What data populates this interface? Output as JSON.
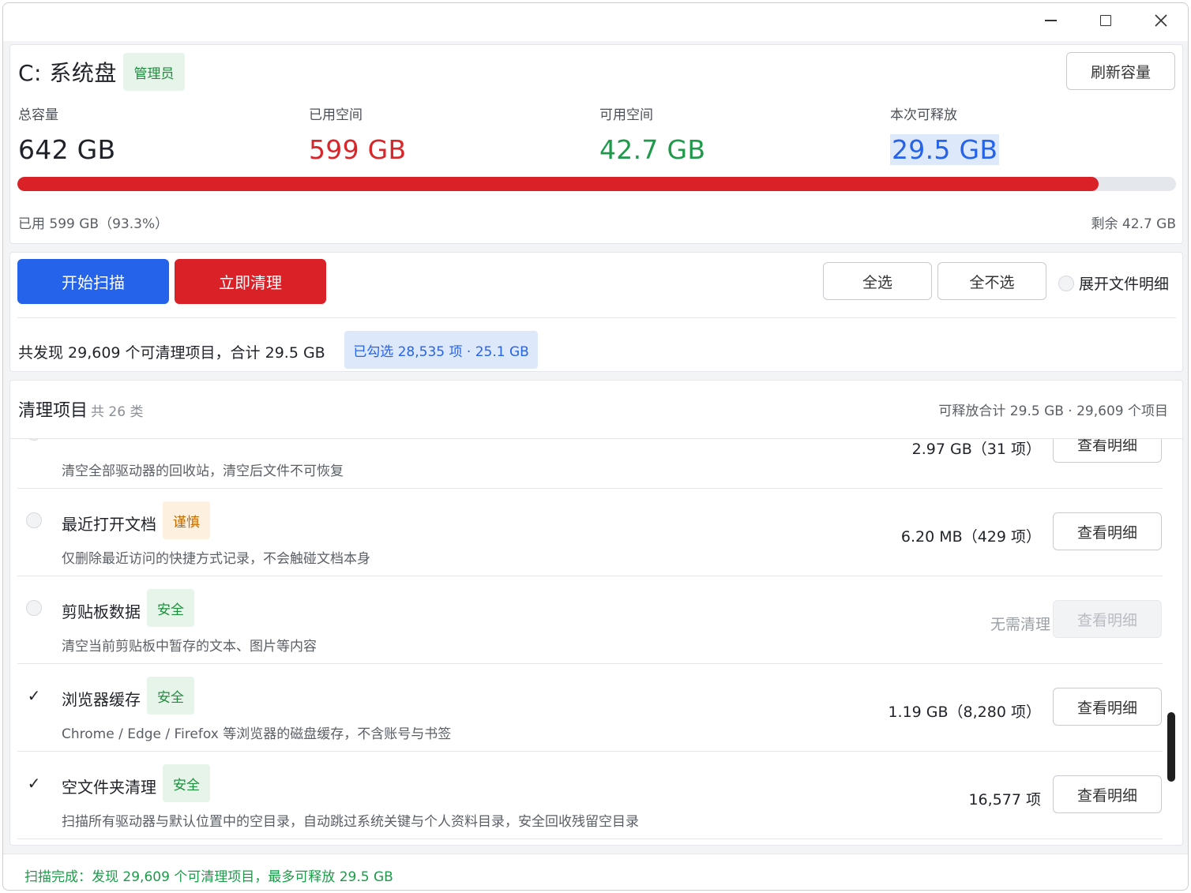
{
  "window": {
    "controls": [
      "minimize",
      "maximize",
      "close"
    ]
  },
  "summary": {
    "drive_title": "C: 系统盘",
    "admin_badge": "管理员",
    "refresh_label": "刷新容量",
    "stats": {
      "total_label": "总容量",
      "total_value": "642 GB",
      "used_label": "已用空间",
      "used_value": "599 GB",
      "free_label": "可用空间",
      "free_value": "42.7 GB",
      "release_label": "本次可释放",
      "release_value": "29.5 GB"
    },
    "usage_fraction": 0.933,
    "used_text": "已用 599 GB（93.3%）",
    "remain_text": "剩余 42.7 GB",
    "colors": {
      "used": "#da2128",
      "free": "#1f9a4b",
      "release": "#2563eb"
    }
  },
  "actions": {
    "scan_label": "开始扫描",
    "clean_label": "立即清理",
    "select_all_label": "全选",
    "select_none_label": "全不选",
    "expand_label": "展开文件明细",
    "found_text": "共发现 29,609 个可清理项目，合计 29.5 GB",
    "selected_text": "已勾选 28,535 项 · 25.1 GB"
  },
  "items": {
    "title": "清理项目",
    "count_text": "共 26 类",
    "summary_text": "可释放合计 29.5 GB · 29,609 个项目",
    "rows": [
      {
        "name": "",
        "tag": "",
        "tag_type": "caution",
        "desc": "清空全部驱动器的回收站，清空后文件不可恢复",
        "size": "2.97 GB（31 项）",
        "detail": "查看明细",
        "checked": false,
        "detail_disabled": false
      },
      {
        "name": "最近打开文档",
        "tag": "谨慎",
        "tag_type": "caution",
        "desc": "仅删除最近访问的快捷方式记录，不会触碰文档本身",
        "size": "6.20 MB（429 项）",
        "detail": "查看明细",
        "checked": false,
        "detail_disabled": false
      },
      {
        "name": "剪贴板数据",
        "tag": "安全",
        "tag_type": "safe",
        "desc": "清空当前剪贴板中暂存的文本、图片等内容",
        "size": "无需清理",
        "detail": "查看明细",
        "checked": false,
        "detail_disabled": true
      },
      {
        "name": "浏览器缓存",
        "tag": "安全",
        "tag_type": "safe",
        "desc": "Chrome / Edge / Firefox 等浏览器的磁盘缓存，不含账号与书签",
        "size": "1.19 GB（8,280 项）",
        "detail": "查看明细",
        "checked": true,
        "detail_disabled": false
      },
      {
        "name": "空文件夹清理",
        "tag": "安全",
        "tag_type": "safe",
        "desc": "扫描所有驱动器与默认位置中的空目录，自动跳过系统关键与个人资料目录，安全回收残留空目录",
        "size": "16,577 项",
        "detail": "查看明细",
        "checked": true,
        "detail_disabled": false
      }
    ]
  },
  "status": {
    "text": "扫描完成：发现 29,609 个可清理项目，最多可释放 29.5 GB"
  }
}
